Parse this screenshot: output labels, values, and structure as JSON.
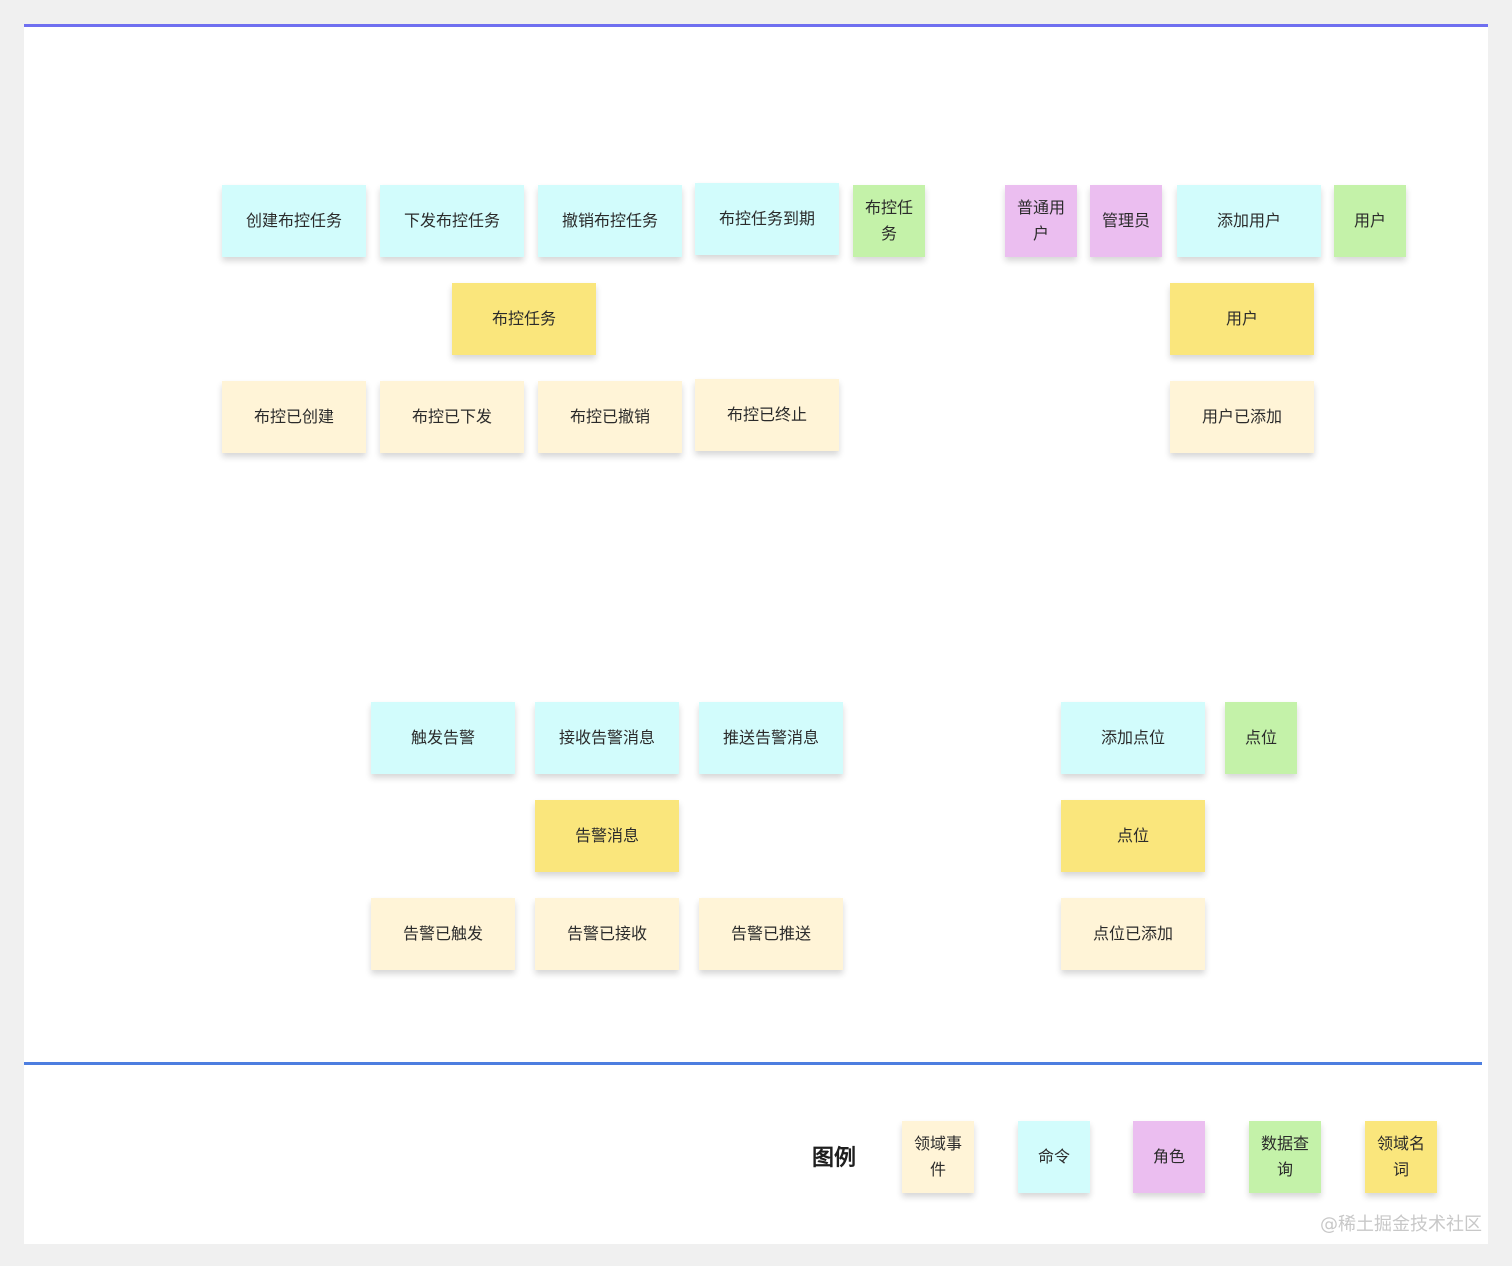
{
  "colors": {
    "top_rule": "#6f6ff0",
    "bottom_rule": "#4d7ee0",
    "command": "#d2fcfc",
    "domain_event": "#fff4d7",
    "domain_noun": "#fae67c",
    "data_query": "#c4f2a9",
    "role": "#ebbef0"
  },
  "groups": {
    "surveillance_task": {
      "commands": [
        "创建布控任务",
        "下发布控任务",
        "撤销布控任务",
        "布控任务到期"
      ],
      "query": [
        "布控任",
        "务"
      ],
      "entity": "布控任务",
      "events": [
        "布控已创建",
        "布控已下发",
        "布控已撤销",
        "布控已终止"
      ]
    },
    "user": {
      "roles": [
        [
          "普通用",
          "户"
        ],
        [
          "管理员"
        ]
      ],
      "command": "添加用户",
      "query": "用户",
      "entity": "用户",
      "event": "用户已添加"
    },
    "alarm": {
      "commands": [
        "触发告警",
        "接收告警消息",
        "推送告警消息"
      ],
      "entity": "告警消息",
      "events": [
        "告警已触发",
        "告警已接收",
        "告警已推送"
      ]
    },
    "location": {
      "command": "添加点位",
      "query": "点位",
      "entity": "点位",
      "event": "点位已添加"
    }
  },
  "legend": {
    "title": "图例",
    "items": [
      {
        "lines": [
          "领域事",
          "件"
        ]
      },
      {
        "lines": [
          "命令"
        ]
      },
      {
        "lines": [
          "角色"
        ]
      },
      {
        "lines": [
          "数据查",
          "询"
        ]
      },
      {
        "lines": [
          "领域名",
          "词"
        ]
      }
    ]
  },
  "watermark": "@稀土掘金技术社区"
}
